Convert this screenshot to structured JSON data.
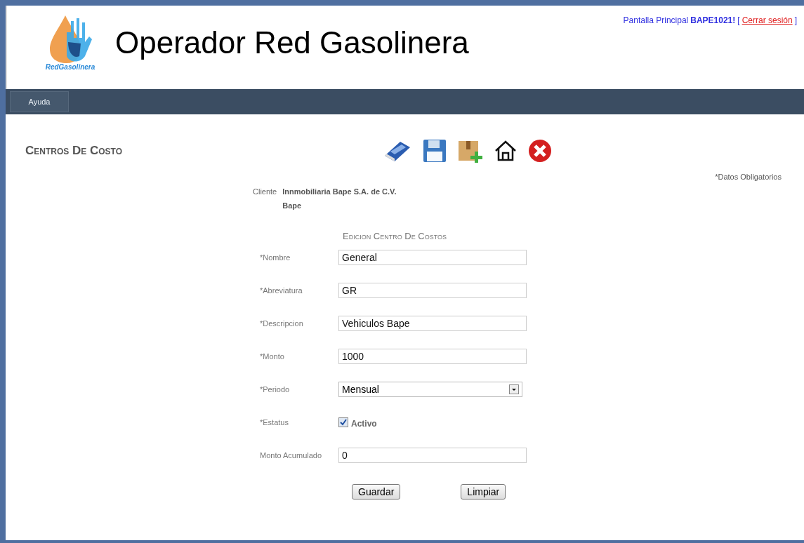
{
  "header": {
    "logo_text": "RedGasolinera",
    "title": "Operador Red Gasolinera",
    "user_prefix": "Pantalla Principal",
    "user": "BAPE1021!",
    "bracket_open": "[",
    "logout": "Cerrar sesión",
    "bracket_close": "]"
  },
  "menu": [
    {
      "label": "Ayuda"
    }
  ],
  "page_title": "Centros De Costo",
  "toolbar": [
    {
      "kind": "eraser"
    },
    {
      "kind": "save"
    },
    {
      "kind": "add-package"
    },
    {
      "kind": "home"
    },
    {
      "kind": "close"
    }
  ],
  "required_note": "*Datos Obligatorios",
  "client": {
    "label": "Cliente",
    "name": "Innmobiliaria Bape S.A. de C.V.",
    "short": "Bape"
  },
  "form_title": "Edicion Centro De Costos",
  "fields": [
    {
      "kind": "text",
      "label": "*Nombre",
      "value": "General"
    },
    {
      "kind": "text",
      "label": "*Abreviatura",
      "value": "GR"
    },
    {
      "kind": "text",
      "label": "*Descripcion",
      "value": "Vehiculos Bape"
    },
    {
      "kind": "text",
      "label": "*Monto",
      "value": "1000"
    },
    {
      "kind": "select",
      "label": "*Periodo",
      "value": "Mensual"
    },
    {
      "kind": "checkbox",
      "label": "*Estatus",
      "value": "Activo",
      "checked": true
    },
    {
      "kind": "text",
      "label": "Monto Acumulado",
      "value": "0"
    }
  ],
  "buttons": [
    "Guardar",
    "Limpiar"
  ]
}
